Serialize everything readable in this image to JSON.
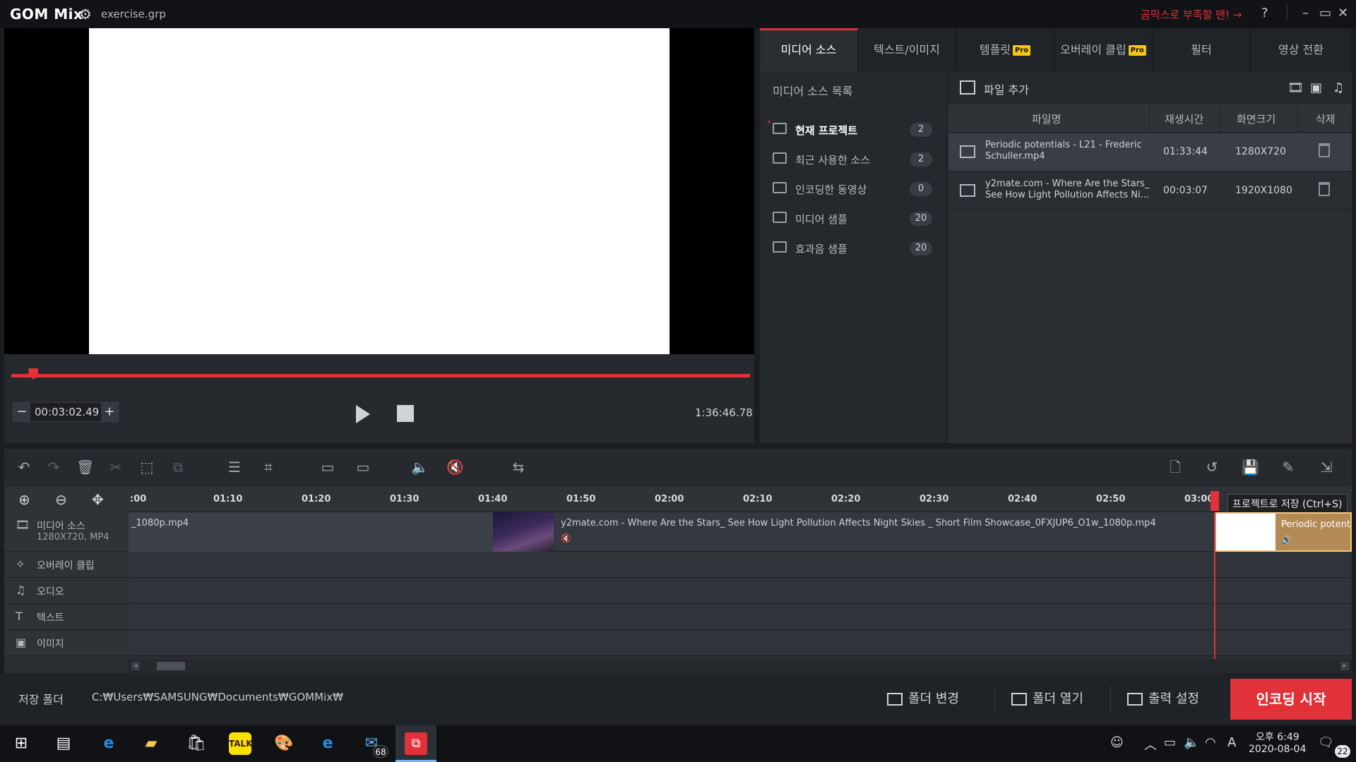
{
  "app": {
    "logo": "GOM Mix",
    "file": "exercise.grp",
    "promo": "곰믹스로 부족할 땐! →",
    "help": "?",
    "window": {
      "minimize": "–",
      "restore": "▭",
      "close": "✕"
    }
  },
  "player": {
    "current_time": "00:03:02.49",
    "minus": "−",
    "plus": "+",
    "duration": "1:36:46.78",
    "progress_fraction": 0.03
  },
  "tabs": [
    {
      "label": "미디어 소스",
      "pro": false,
      "active": true
    },
    {
      "label": "텍스트/이미지",
      "pro": false,
      "active": false
    },
    {
      "label": "템플릿",
      "pro": true,
      "active": false
    },
    {
      "label": "오버레이 클립",
      "pro": true,
      "active": false
    },
    {
      "label": "필터",
      "pro": false,
      "active": false
    },
    {
      "label": "영상 전환",
      "pro": false,
      "active": false
    }
  ],
  "pro_badge": "Pro",
  "source_list": {
    "title": "미디어 소스 목록",
    "items": [
      {
        "label": "현재 프로젝트",
        "count": "2",
        "active": true
      },
      {
        "label": "최근 사용한 소스",
        "count": "2"
      },
      {
        "label": "인코딩한 동영상",
        "count": "0"
      },
      {
        "label": "미디어 샘플",
        "count": "20"
      },
      {
        "label": "효과음 샘플",
        "count": "20"
      }
    ],
    "active_mark": "*"
  },
  "file_panel": {
    "add_label": "파일 추가",
    "columns": [
      "파일명",
      "재생시간",
      "화면크기",
      "삭제"
    ],
    "rows": [
      {
        "name": "Periodic potentials - L21 - Frederic Schuller.mp4",
        "duration": "01:33:44",
        "size": "1280X720"
      },
      {
        "name": "y2mate.com - Where Are the Stars_ See How Light Pollution Affects Ni...",
        "duration": "00:03:07",
        "size": "1920X1080"
      }
    ]
  },
  "timeline": {
    "ticks": [
      ":00",
      "01:10",
      "01:20",
      "01:30",
      "01:40",
      "01:50",
      "02:00",
      "02:10",
      "02:20",
      "02:30",
      "02:40",
      "02:50",
      "03:00"
    ],
    "tracks": [
      {
        "label": "미디어 소스",
        "sub": "1280X720, MP4"
      },
      {
        "label": "오버레이 클립"
      },
      {
        "label": "오디오"
      },
      {
        "label": "텍스트"
      },
      {
        "label": "이미지"
      }
    ],
    "clip1": "_1080p.mp4",
    "clip2": "y2mate.com - Where Are the Stars_ See How Light Pollution Affects Night Skies _ Short Film Showcase_0FXJUP6_O1w_1080p.mp4",
    "clip3": "Periodic potentials",
    "tooltip": "프로젝트로 저장 (Ctrl+S)"
  },
  "bottom": {
    "save_folder_label": "저장 폴더",
    "save_path": "C:₩Users₩SAMSUNG₩Documents₩GOMMix₩",
    "change_folder": "폴더 변경",
    "open_folder": "폴더 열기",
    "output_settings": "출력 설정",
    "encode": "인코딩 시작"
  },
  "taskbar": {
    "mail_badge": "68",
    "time": "오후 6:49",
    "date": "2020-08-04",
    "notifications": "22",
    "ime": "A"
  },
  "colors": {
    "accent": "#e03238",
    "pro": "#f5c518"
  }
}
